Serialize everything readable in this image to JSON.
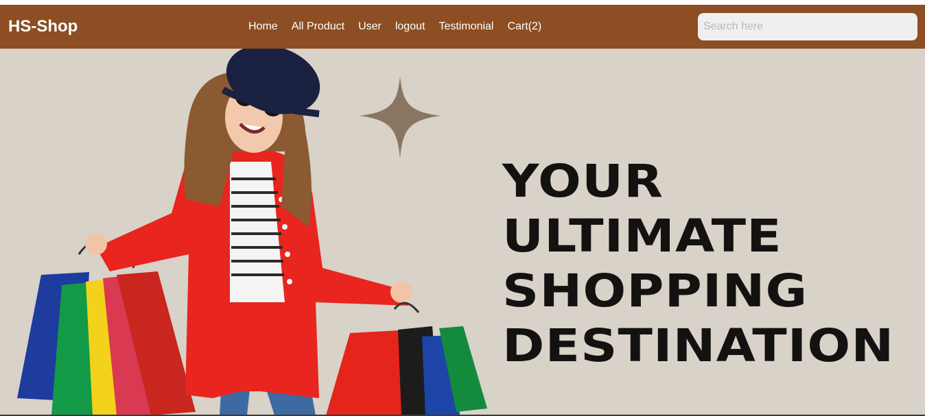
{
  "brand": {
    "name": "HS-Shop"
  },
  "nav": {
    "items": [
      {
        "label": "Home"
      },
      {
        "label": "All Product"
      },
      {
        "label": "User"
      },
      {
        "label": "logout"
      },
      {
        "label": "Testimonial"
      },
      {
        "label": "Cart(2)"
      }
    ]
  },
  "search": {
    "placeholder": "Search here",
    "value": ""
  },
  "hero": {
    "headline": [
      "YOUR",
      "ULTIMATE",
      "SHOPPING",
      "DESTINATION"
    ]
  },
  "colors": {
    "navbar": "#8c4e22",
    "hero_background": "#d8d2c8",
    "headline": "#141210",
    "sparkle": "#8a7562",
    "coat": "#e8251f"
  },
  "icons": {
    "sparkle": "four-point-star-icon"
  }
}
